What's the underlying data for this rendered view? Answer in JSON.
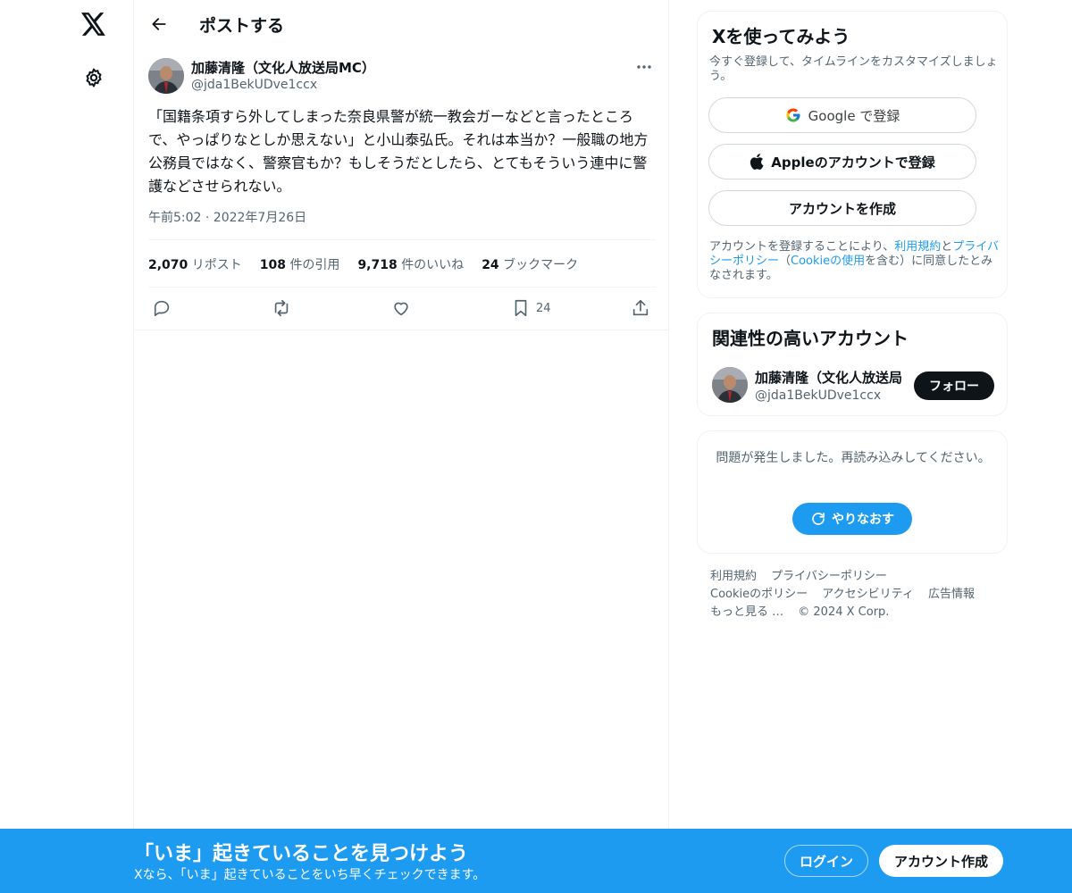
{
  "nav": {
    "logo_icon": "x-logo-icon",
    "settings_icon": "gear-icon"
  },
  "header": {
    "back_icon": "arrow-left-icon",
    "title": "ポストする"
  },
  "post": {
    "author_name": "加藤清隆（文化人放送局MC）",
    "author_handle": "@jda1BekUDve1ccx",
    "text": "「国籍条項すら外してしまった奈良県警が統一教会ガーなどと言ったところで、やっぱりなとしか思えない」と小山泰弘氏。それは本当か？一般職の地方公務員ではなく、警察官もか？もしそうだとしたら、とてもそういう連中に警護などさせられない。",
    "timestamp": "午前5:02 · 2022年7月26日",
    "stats": {
      "reposts_count": "2,070",
      "reposts_label": "リポスト",
      "quotes_count": "108",
      "quotes_label": "件の引用",
      "likes_count": "9,718",
      "likes_label": "件のいいね",
      "bookmarks_count": "24",
      "bookmarks_label": "ブックマーク"
    },
    "actions": {
      "bookmark_count": "24"
    }
  },
  "signup_card": {
    "title": "Xを使ってみよう",
    "subtitle": "今すぐ登録して、タイムラインをカスタマイズしましょう。",
    "google_label": "Google で登録",
    "apple_label": "Appleのアカウントで登録",
    "create_label": "アカウントを作成",
    "legal_1": "アカウントを登録することにより、",
    "legal_terms": "利用規約",
    "legal_2": "と",
    "legal_privacy": "プライバシーポリシー",
    "legal_3": "（",
    "legal_cookie": "Cookieの使用",
    "legal_4": "を含む）に同意したとみなされます。"
  },
  "related_card": {
    "title": "関連性の高いアカウント",
    "name": "加藤清隆（文化人放送局",
    "handle": "@jda1BekUDve1ccx",
    "follow_label": "フォロー"
  },
  "error_card": {
    "message": "問題が発生しました。再読み込みしてください。",
    "retry_label": "やりなおす"
  },
  "footer": {
    "terms": "利用規約",
    "privacy": "プライバシーポリシー",
    "cookie": "Cookieのポリシー",
    "accessibility": "アクセシビリティ",
    "ads": "広告情報",
    "more": "もっと見る …",
    "copyright": "© 2024 X Corp."
  },
  "banner": {
    "headline": "「いま」起きていることを見つけよう",
    "subline": "Xなら、「いま」起きていることをいち早くチェックできます。",
    "login_label": "ログイン",
    "signup_label": "アカウント作成"
  },
  "colors": {
    "accent": "#1d9bf0",
    "text": "#0f1419",
    "muted": "#536471",
    "border": "#eff3f4"
  }
}
